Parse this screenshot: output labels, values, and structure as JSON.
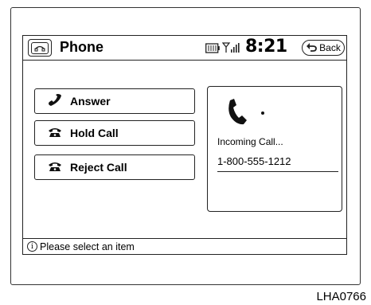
{
  "header": {
    "title": "Phone",
    "clock": "8:21",
    "back_label": "Back",
    "icons": [
      "phone-icon",
      "battery-icon",
      "signal-icon",
      "back-arrow-icon"
    ]
  },
  "actions": [
    {
      "label": "Answer",
      "icon": "handset-icon"
    },
    {
      "label": "Hold Call",
      "icon": "desk-phone-icon"
    },
    {
      "label": "Reject Call",
      "icon": "desk-phone-icon"
    }
  ],
  "call": {
    "status": "Incoming Call...",
    "number": "1-800-555-1212",
    "icon": "ringing-phone-icon"
  },
  "footer": {
    "message": "Please select an item",
    "icon": "info-icon"
  },
  "figure_code": "LHA0766"
}
